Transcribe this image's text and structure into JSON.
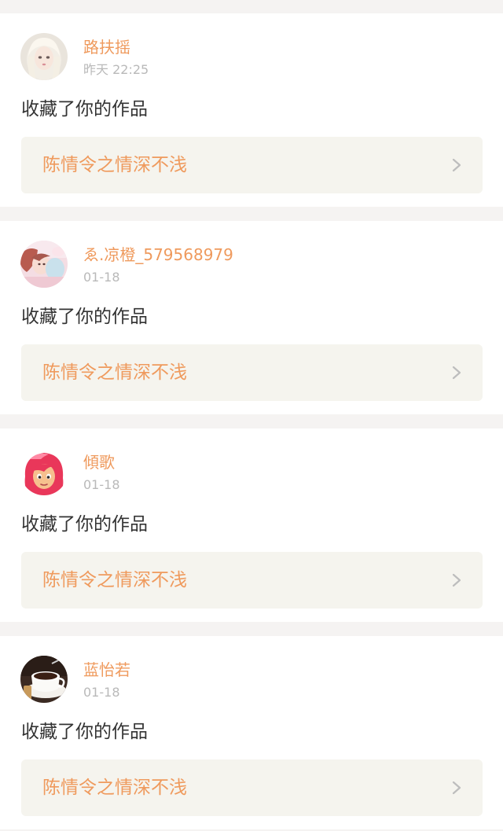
{
  "notifications": [
    {
      "username": "路扶摇",
      "time": "昨天 22:25",
      "action": "收藏了你的作品",
      "work_title": "陈情令之情深不浅",
      "avatar_icon": "doll-avatar-icon"
    },
    {
      "username": "ゑ.凉橙_579568979",
      "time": "01-18",
      "action": "收藏了你的作品",
      "work_title": "陈情令之情深不浅",
      "avatar_icon": "pink-girl-avatar-icon"
    },
    {
      "username": "傾歌",
      "time": "01-18",
      "action": "收藏了你的作品",
      "work_title": "陈情令之情深不浅",
      "avatar_icon": "cartoon-girl-avatar-icon"
    },
    {
      "username": "蓝怡若",
      "time": "01-18",
      "action": "收藏了你的作品",
      "work_title": "陈情令之情深不浅",
      "avatar_icon": "coffee-avatar-icon"
    }
  ],
  "colors": {
    "accent": "#ef9a5d",
    "timestamp": "#b9b9b9",
    "body_text": "#333333",
    "link_bg": "#f5f4ee",
    "page_bg": "#f5f3f2"
  }
}
